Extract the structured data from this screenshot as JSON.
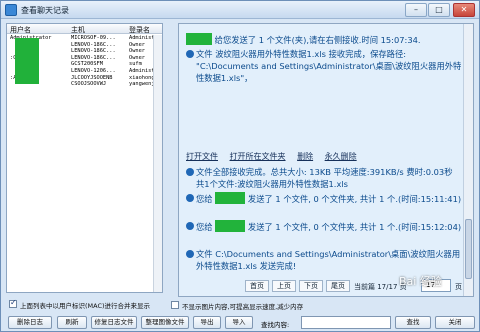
{
  "window": {
    "title": "查看聊天记录",
    "min_label": "–",
    "max_label": "□",
    "close_label": "✕"
  },
  "userlist": {
    "headers": [
      "用户名",
      "主机",
      "登录名"
    ],
    "rows": [
      [
        "Administrator",
        "MICROSOF-09...",
        "Administra"
      ],
      [
        "",
        "LENOVO-186C...",
        "Owner"
      ],
      [
        "",
        "LENOVO-186C...",
        "Owner"
      ],
      [
        ":Owner",
        "LENOVO-186C...",
        "Owner"
      ],
      [
        "",
        "GCST200SFM",
        "sufm"
      ],
      [
        "",
        "LENOVO-1206...",
        "Administra"
      ],
      [
        ":Admin...",
        "JLCOOYJSOOENB",
        "xiaohonghi"
      ],
      [
        "",
        "CSOOJSOOVWJ",
        "yangwenji"
      ]
    ]
  },
  "chat": {
    "line1": "给您发送了 1 个文件(夹),请在右侧接收.时间 15:07:34.",
    "line2": "文件 波纹阻火器用外特性数据1.xls 接收完成，保存路径: \"C:\\Documents and Settings\\Administrator\\桌面\\波纹阻火器用外特性数据1.xls\"，",
    "links": [
      "打开文件",
      "打开所在文件夹",
      "删除",
      "永久删除"
    ],
    "line3": "文件全部接收完成。总共大小: 13KB 平均速度:391KB/s 费时:0.03秒  共1个文件:波纹阻火器用外特性数据1.xls",
    "line4a": "您给",
    "line4b": "发送了 1 个文件, 0 个文件夹, 共计 1 个.(时间:15:11:41)",
    "line5a": "您给",
    "line5b": "发送了 1 个文件, 0 个文件夹, 共计 1 个.(时间:15:12:04)",
    "line6": "文件 C:\\Documents and Settings\\Administrator\\桌面\\波纹阻火器用外特性数据1.xls 发送完成!"
  },
  "paging": {
    "first": "首页",
    "prev": "上页",
    "next": "下页",
    "last": "尾页",
    "info": "当前篇 17/17 页",
    "page": "17",
    "unit": "页"
  },
  "options": {
    "opt1": "上面列表中以用户标识(MAC)进行合并来显示",
    "opt2": "不显示图片内容,可提高显示速度,减少内存"
  },
  "bottom": {
    "delete_log": "删除日志",
    "refresh": "刷新",
    "fix_file": "修复日志文件",
    "merge_images": "整理图像文件",
    "export": "导出",
    "import": "导入",
    "find_label": "查找内容:",
    "find_value": "",
    "find_btn": "查找",
    "close_btn": "关闭"
  },
  "watermark": "Bai 经验"
}
